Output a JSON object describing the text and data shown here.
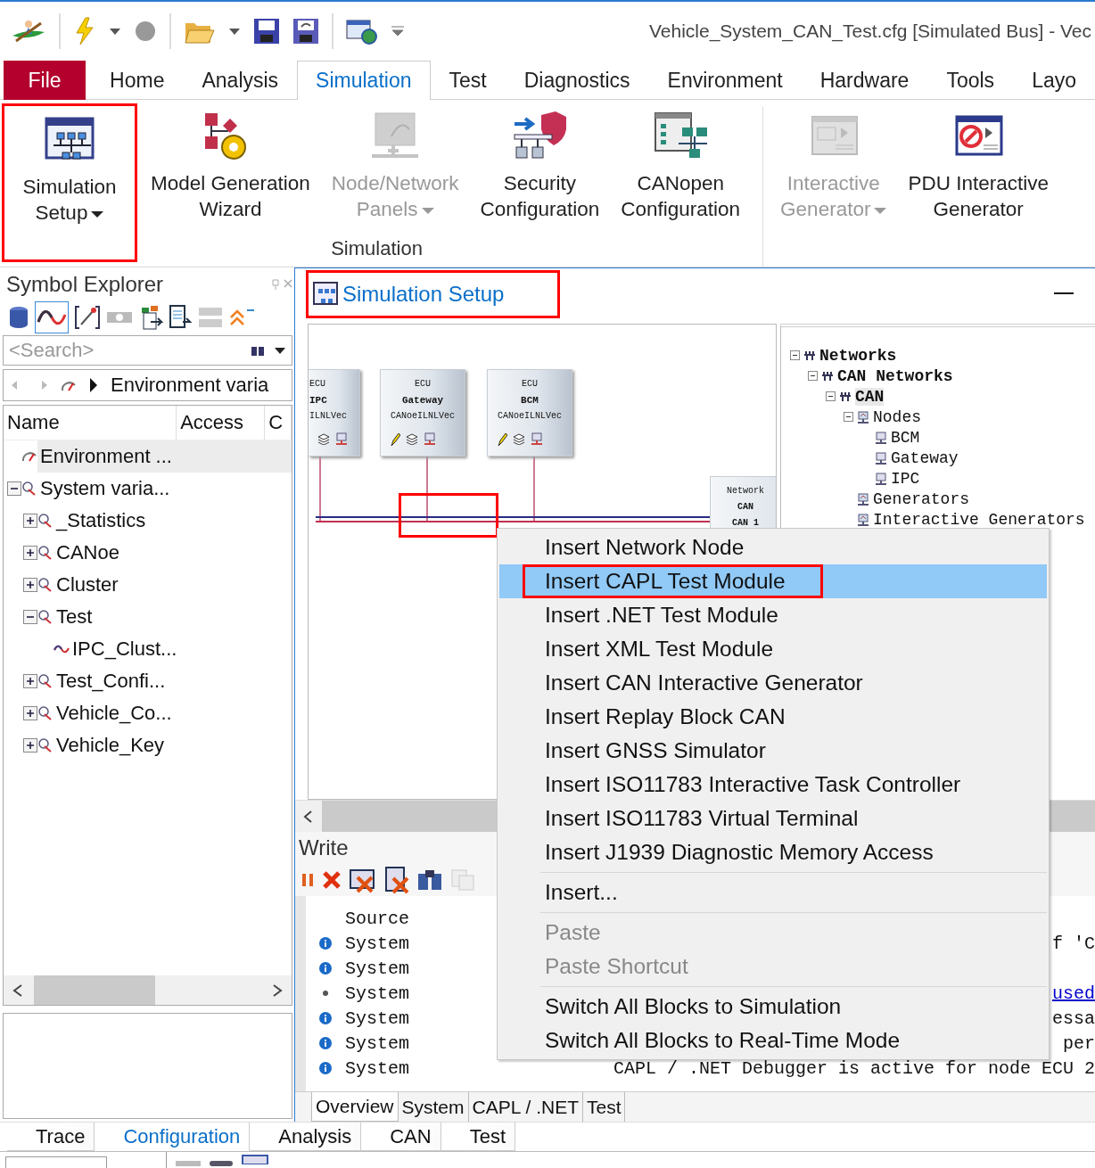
{
  "window": {
    "title": "Vehicle_System_CAN_Test.cfg [Simulated Bus] - Vec"
  },
  "ribbon_tabs": [
    {
      "label": "File",
      "kind": "file",
      "selected": false
    },
    {
      "label": "Home",
      "kind": "tab",
      "selected": false
    },
    {
      "label": "Analysis",
      "kind": "tab",
      "selected": false
    },
    {
      "label": "Simulation",
      "kind": "tab",
      "selected": true
    },
    {
      "label": "Test",
      "kind": "tab",
      "selected": false
    },
    {
      "label": "Diagnostics",
      "kind": "tab",
      "selected": false
    },
    {
      "label": "Environment",
      "kind": "tab",
      "selected": false
    },
    {
      "label": "Hardware",
      "kind": "tab",
      "selected": false
    },
    {
      "label": "Tools",
      "kind": "tab",
      "selected": false
    },
    {
      "label": "Layo",
      "kind": "tab",
      "selected": false
    }
  ],
  "ribbon_groups": [
    {
      "label": "Simulation",
      "buttons": [
        {
          "lines": [
            "Simulation",
            "Setup"
          ],
          "dropdown": true,
          "disabled": false,
          "highlighted": true
        },
        {
          "lines": [
            "Model Generation",
            "Wizard"
          ],
          "dropdown": false,
          "disabled": false,
          "highlighted": false
        },
        {
          "lines": [
            "Node/Network",
            "Panels"
          ],
          "dropdown": true,
          "disabled": true,
          "highlighted": false
        },
        {
          "lines": [
            "Security",
            "Configuration"
          ],
          "dropdown": false,
          "disabled": false,
          "highlighted": false
        },
        {
          "lines": [
            "CANopen",
            "Configuration"
          ],
          "dropdown": false,
          "disabled": false,
          "highlighted": false
        }
      ]
    },
    {
      "buttons": [
        {
          "lines": [
            "Interactive",
            "Generator"
          ],
          "dropdown": true,
          "disabled": true,
          "highlighted": false
        },
        {
          "lines": [
            "PDU Interactive",
            "Generator"
          ],
          "dropdown": false,
          "disabled": false,
          "highlighted": false
        }
      ]
    }
  ],
  "symbol_explorer": {
    "title": "Symbol Explorer",
    "search": {
      "placeholder": "<Search>"
    },
    "breadcrumb": "Environment varia",
    "columns": [
      "Name",
      "Access",
      "C"
    ],
    "tree": [
      {
        "label": "Environment ...",
        "kind": "environment",
        "selected": true
      },
      {
        "label": "System varia...",
        "kind": "namespace",
        "selected": false,
        "expanded": true,
        "children": [
          {
            "label": "_Statistics",
            "kind": "namespace",
            "selected": false,
            "expanded": false
          },
          {
            "label": "CANoe",
            "kind": "namespace",
            "selected": false,
            "expanded": false
          },
          {
            "label": "Cluster",
            "kind": "namespace",
            "selected": false,
            "expanded": false
          },
          {
            "label": "Test",
            "kind": "namespace",
            "selected": false,
            "expanded": true,
            "children": [
              {
                "label": "IPC_Clust...",
                "kind": "variable",
                "selected": false
              }
            ]
          },
          {
            "label": "Test_Confi...",
            "kind": "namespace",
            "selected": false,
            "expanded": false
          },
          {
            "label": "Vehicle_Co...",
            "kind": "namespace",
            "selected": false,
            "expanded": false
          },
          {
            "label": "Vehicle_Key",
            "kind": "namespace",
            "selected": false,
            "expanded": false
          }
        ]
      }
    ]
  },
  "simulation_setup": {
    "title": "Simulation Setup",
    "highlighted": true,
    "diagram": {
      "bus_highlight": true,
      "nodes": [
        {
          "lines": [
            "ECU",
            "IPC",
            "ILNLVec"
          ],
          "partial": true
        },
        {
          "lines": [
            "ECU",
            "Gateway",
            "CANoeILNLVec"
          ],
          "partial": false
        },
        {
          "lines": [
            "ECU",
            "BCM",
            "CANoeILNLVec"
          ],
          "partial": false
        }
      ],
      "network_block": [
        "Network",
        "CAN",
        "CAN 1"
      ]
    },
    "tree": [
      {
        "label": "Networks",
        "kind": "network",
        "selected": false,
        "expanded": true,
        "children": [
          {
            "label": "CAN Networks",
            "kind": "network",
            "selected": false,
            "expanded": true,
            "children": [
              {
                "label": "CAN",
                "kind": "network",
                "selected": true,
                "expanded": true,
                "children": [
                  {
                    "label": "Nodes",
                    "kind": "folder",
                    "selected": false,
                    "expanded": true,
                    "children": [
                      {
                        "label": "BCM",
                        "kind": "node",
                        "selected": false
                      },
                      {
                        "label": "Gateway",
                        "kind": "node",
                        "selected": false
                      },
                      {
                        "label": "IPC",
                        "kind": "node",
                        "selected": false
                      }
                    ]
                  },
                  {
                    "label": "Generators",
                    "kind": "folder",
                    "selected": false
                  },
                  {
                    "label": "Interactive Generators",
                    "kind": "folder",
                    "selected": false
                  }
                ]
              }
            ]
          }
        ]
      }
    ]
  },
  "write": {
    "title": "Write",
    "columns": [
      "Source"
    ],
    "rows": [
      {
        "kind": "info",
        "source": "System",
        "message": "f 'C",
        "link": false
      },
      {
        "kind": "info",
        "source": "System"
      },
      {
        "kind": "note",
        "source": "System",
        "message": "used",
        "link": true
      },
      {
        "kind": "info",
        "source": "System",
        "message": "essa",
        "link": false
      },
      {
        "kind": "info",
        "source": "System",
        "message": "per",
        "link": false
      },
      {
        "kind": "info",
        "source": "System",
        "message": "CAPL / .NET Debugger is active for node ECU 2",
        "link": false
      }
    ],
    "tabs": [
      {
        "label": "Overview",
        "selected": true
      },
      {
        "label": "System",
        "selected": false
      },
      {
        "label": "CAPL / .NET",
        "selected": false
      },
      {
        "label": "Test",
        "selected": false
      }
    ]
  },
  "context_menu": [
    {
      "kind": "item",
      "label": "Insert Network Node",
      "selected": false,
      "disabled": false,
      "highlighted": false
    },
    {
      "kind": "item",
      "label": "Insert CAPL Test Module",
      "selected": true,
      "disabled": false,
      "highlighted": true
    },
    {
      "kind": "item",
      "label": "Insert .NET Test Module",
      "selected": false,
      "disabled": false,
      "highlighted": false
    },
    {
      "kind": "item",
      "label": "Insert XML Test Module",
      "selected": false,
      "disabled": false,
      "highlighted": false
    },
    {
      "kind": "item",
      "label": "Insert CAN Interactive Generator",
      "selected": false,
      "disabled": false,
      "highlighted": false
    },
    {
      "kind": "item",
      "label": "Insert Replay Block CAN",
      "selected": false,
      "disabled": false,
      "highlighted": false
    },
    {
      "kind": "item",
      "label": "Insert GNSS Simulator",
      "selected": false,
      "disabled": false,
      "highlighted": false
    },
    {
      "kind": "item",
      "label": "Insert ISO11783 Interactive Task Controller",
      "selected": false,
      "disabled": false,
      "highlighted": false
    },
    {
      "kind": "item",
      "label": "Insert ISO11783 Virtual Terminal",
      "selected": false,
      "disabled": false,
      "highlighted": false
    },
    {
      "kind": "item",
      "label": "Insert J1939 Diagnostic Memory Access",
      "selected": false,
      "disabled": false,
      "highlighted": false
    },
    {
      "kind": "separator"
    },
    {
      "kind": "item",
      "label": "Insert...",
      "selected": false,
      "disabled": false,
      "highlighted": false
    },
    {
      "kind": "separator"
    },
    {
      "kind": "item",
      "label": "Paste",
      "selected": false,
      "disabled": true,
      "highlighted": false
    },
    {
      "kind": "item",
      "label": "Paste Shortcut",
      "selected": false,
      "disabled": true,
      "highlighted": false
    },
    {
      "kind": "separator"
    },
    {
      "kind": "item",
      "label": "Switch All Blocks to Simulation",
      "selected": false,
      "disabled": false,
      "highlighted": false
    },
    {
      "kind": "item",
      "label": "Switch All Blocks to Real-Time Mode",
      "selected": false,
      "disabled": false,
      "highlighted": false
    }
  ],
  "bottom_tabs": [
    {
      "label": "Trace",
      "selected": false
    },
    {
      "label": "Configuration",
      "selected": true
    },
    {
      "label": "Analysis",
      "selected": false
    },
    {
      "label": "CAN",
      "selected": false
    },
    {
      "label": "Test",
      "selected": false
    }
  ]
}
